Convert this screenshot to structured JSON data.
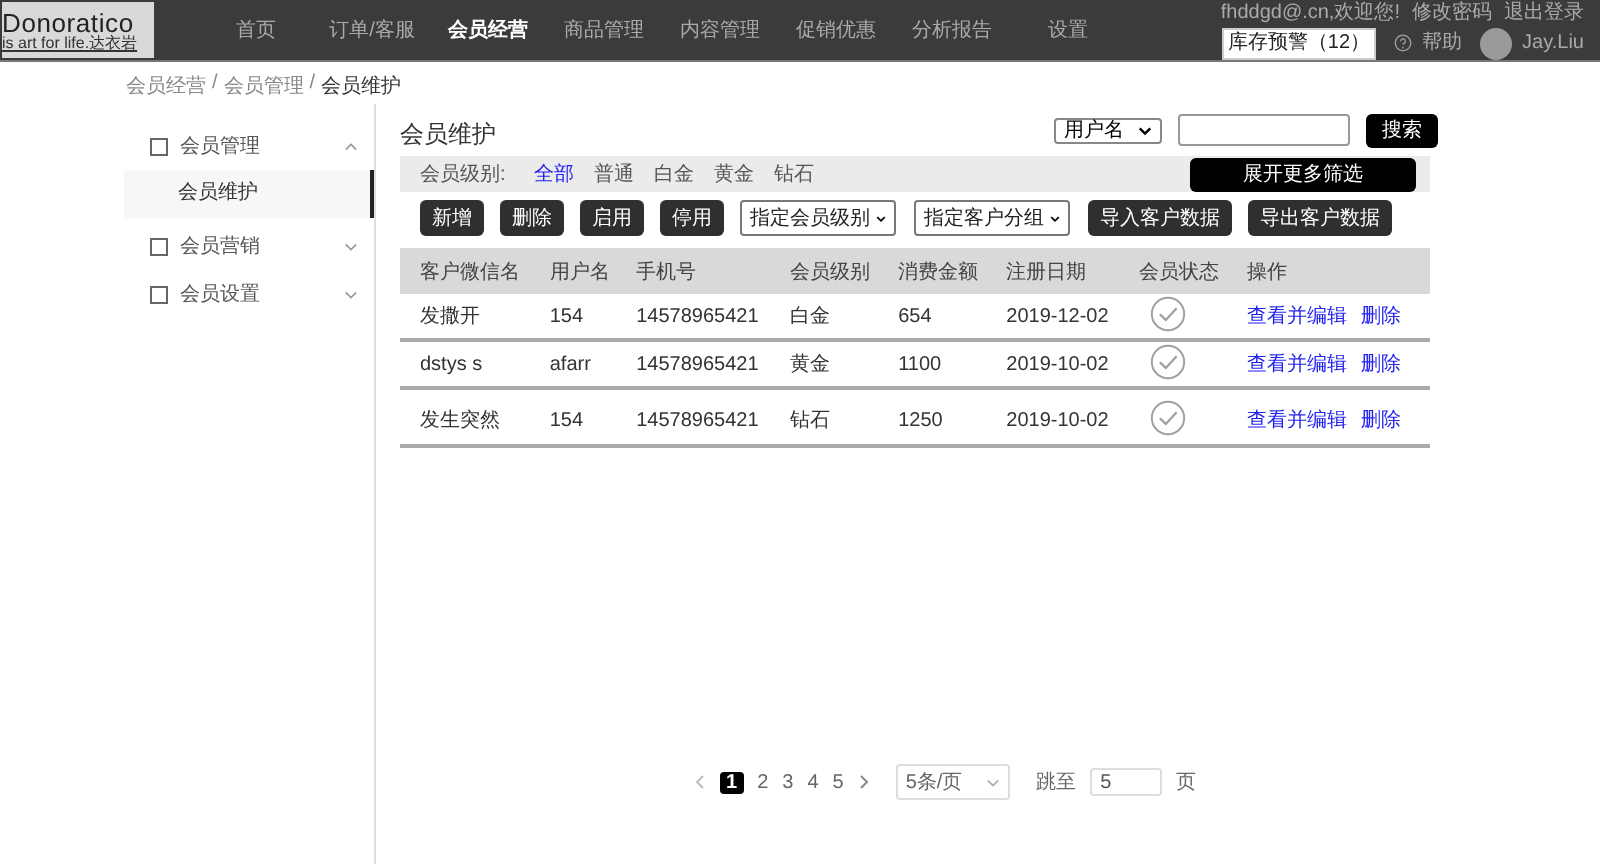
{
  "header": {
    "logo": {
      "title": "Donoratico",
      "tagline": "is art for life.达衣岩"
    },
    "nav": [
      {
        "label": "首页",
        "selected": false
      },
      {
        "label": "订单/客服",
        "selected": false
      },
      {
        "label": "会员经营",
        "selected": true
      },
      {
        "label": "商品管理",
        "selected": false
      },
      {
        "label": "内容管理",
        "selected": false
      },
      {
        "label": "促销优惠",
        "selected": false
      },
      {
        "label": "分析报告",
        "selected": false
      },
      {
        "label": "设置",
        "selected": false
      }
    ],
    "welcome": "fhddgd@.cn,欢迎您!",
    "change_password": "修改密码",
    "logout": "退出登录",
    "stock_alert": "库存预警（12）",
    "help": "帮助",
    "user_name": "Jay.Liu"
  },
  "breadcrumb": [
    {
      "label": "会员经营",
      "separator": "/"
    },
    {
      "label": "会员管理",
      "separator": "/"
    },
    {
      "label": "会员维护"
    }
  ],
  "sidebar": {
    "items": [
      {
        "label": "会员管理",
        "expanded": true,
        "children": [
          {
            "label": "会员维护",
            "selected": true
          }
        ]
      },
      {
        "label": "会员营销",
        "expanded": false
      },
      {
        "label": "会员设置",
        "expanded": false
      }
    ]
  },
  "page_title": "会员维护",
  "search": {
    "field_select": "用户名",
    "button": "搜索"
  },
  "filter": {
    "label": "会员级别:",
    "options": [
      {
        "label": "全部",
        "selected": true
      },
      {
        "label": "普通",
        "selected": false
      },
      {
        "label": "白金",
        "selected": false
      },
      {
        "label": "黄金",
        "selected": false
      },
      {
        "label": "钻石",
        "selected": false
      }
    ],
    "more_button": "展开更多筛选"
  },
  "toolbar": [
    {
      "kind": "button",
      "label": "新增"
    },
    {
      "kind": "button",
      "label": "删除"
    },
    {
      "kind": "button",
      "label": "启用"
    },
    {
      "kind": "button",
      "label": "停用"
    },
    {
      "kind": "select",
      "label": "指定会员级别"
    },
    {
      "kind": "select",
      "label": "指定客户分组"
    },
    {
      "kind": "button",
      "label": "导入客户数据"
    },
    {
      "kind": "button",
      "label": "导出客户数据"
    }
  ],
  "table": {
    "columns": [
      "客户微信名",
      "用户名",
      "手机号",
      "会员级别",
      "消费金额",
      "注册日期",
      "会员状态",
      "操作"
    ],
    "rows": [
      {
        "cells": [
          "发撒开",
          "154",
          "14578965421",
          "白金",
          "654",
          "2019-12-02"
        ],
        "active": true,
        "actions": [
          "查看并编辑",
          "删除"
        ]
      },
      {
        "cells": [
          "dstys s",
          "afarr",
          "14578965421",
          "黄金",
          "1100",
          "2019-10-02"
        ],
        "active": true,
        "actions": [
          "查看并编辑",
          "删除"
        ]
      },
      {
        "cells": [
          "发生突然",
          "154",
          "14578965421",
          "钻石",
          "1250",
          "2019-10-02"
        ],
        "active": true,
        "actions": [
          "查看并编辑",
          "删除"
        ]
      }
    ]
  },
  "pagination": {
    "pages": [
      {
        "label": "1",
        "selected": true
      },
      {
        "label": "2",
        "selected": false
      },
      {
        "label": "3",
        "selected": false
      },
      {
        "label": "4",
        "selected": false
      },
      {
        "label": "5",
        "selected": false
      }
    ],
    "page_size": "5条/页",
    "jump_label": "跳至",
    "jump_value": "5",
    "page_unit": "页"
  }
}
